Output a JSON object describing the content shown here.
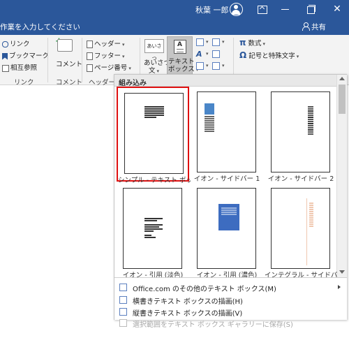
{
  "titlebar": {
    "username": "秋葉 一郎",
    "close_glyph": "✕"
  },
  "tellme": {
    "text": "作業を入力してください",
    "share_label": "共有"
  },
  "ribbon": {
    "links_group": {
      "link": "リンク",
      "bookmark": "ブックマーク",
      "cross_reference": "相互参照",
      "label": "リンク"
    },
    "comments_group": {
      "comment": "コメント",
      "label": "コメント"
    },
    "header_footer_group": {
      "header": "ヘッダー",
      "footer": "フッター",
      "page_number": "ページ番号",
      "label": "ヘッダーと"
    },
    "text_group": {
      "greeting_icon_text": "あいさつ",
      "greeting_line1": "あいさつ",
      "greeting_line2": "文",
      "textbox_line1": "テキスト",
      "textbox_line2": "ボックス"
    },
    "symbols_group": {
      "equation": "数式",
      "symbol": "記号と特殊文字"
    }
  },
  "gallery": {
    "section_title": "組み込み",
    "items": [
      {
        "label": "シンプル - テキスト ボッ...",
        "selected": true
      },
      {
        "label": "イオン - サイドバー 1"
      },
      {
        "label": "イオン - サイドバー 2"
      },
      {
        "label": "イオン - 引用 (淡色)"
      },
      {
        "label": "イオン - 引用 (濃色)"
      },
      {
        "label": "インテグラル - サイドバー"
      }
    ],
    "menu": {
      "more_office": "Office.com のその他のテキスト ボックス(M)",
      "draw_horizontal": "横書きテキスト ボックスの描画(H)",
      "draw_vertical": "縦書きテキスト ボックスの描画(V)",
      "save_selection": "選択範囲をテキスト ボックス ギャラリーに保存(S)"
    }
  },
  "colors": {
    "word_blue": "#2b579a",
    "ribbon_bg": "#f3f3f3",
    "selection_red": "#e01010",
    "pressed_button": "#c5c5c5"
  }
}
